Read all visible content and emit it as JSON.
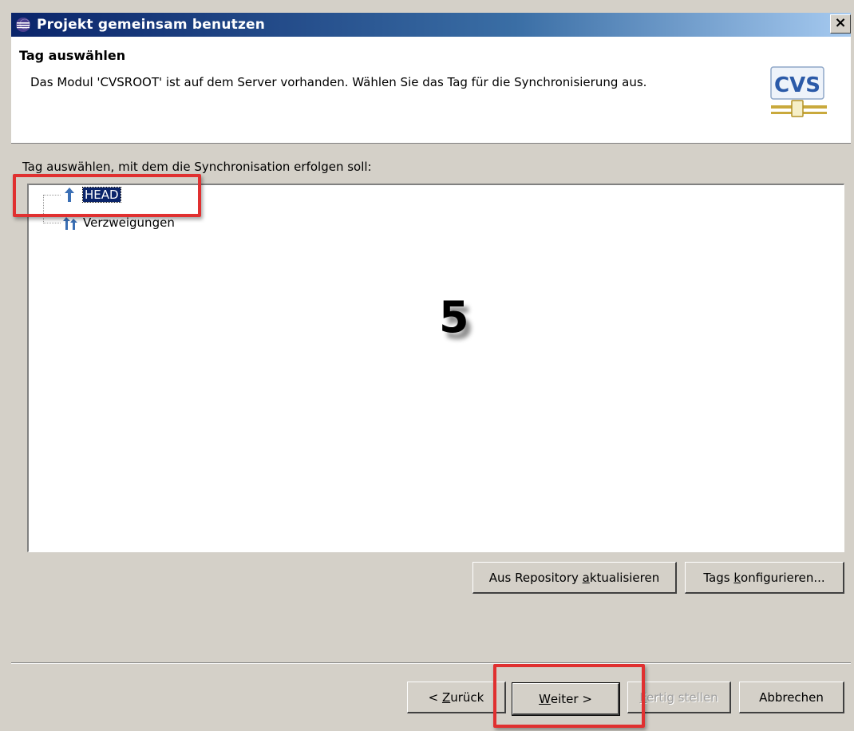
{
  "window": {
    "title": "Projekt gemeinsam benutzen",
    "close_label": "×"
  },
  "header": {
    "title": "Tag auswählen",
    "description": "Das Modul 'CVSROOT' ist auf dem Server vorhanden. Wählen Sie das Tag für die Synchronisierung aus.",
    "logo_text": "CVS"
  },
  "body": {
    "section_label": "Tag auswählen, mit dem die Synchronisation erfolgen soll:",
    "tree": [
      {
        "label": "HEAD",
        "icon": "head-arrow-icon",
        "selected": true
      },
      {
        "label": "Verzweigungen",
        "icon": "branches-icon",
        "selected": false
      }
    ],
    "step_number": "5"
  },
  "buttons": {
    "refresh": {
      "pre": "Aus Repository ",
      "accel": "a",
      "post": "ktualisieren"
    },
    "configure": {
      "pre": "Tags ",
      "accel": "k",
      "post": "onfigurieren..."
    },
    "back": {
      "pre": "< ",
      "accel": "Z",
      "post": "urück"
    },
    "next": {
      "pre": "",
      "accel": "W",
      "post": "eiter >"
    },
    "finish": {
      "pre": "",
      "accel": "F",
      "post": "ertig stellen"
    },
    "cancel": {
      "label": "Abbrechen"
    }
  },
  "colors": {
    "highlight": "#e03030",
    "selection": "#0a246a",
    "titlebar_start": "#0a246a",
    "titlebar_end": "#a6caf0",
    "dialog_bg": "#d4d0c8"
  }
}
